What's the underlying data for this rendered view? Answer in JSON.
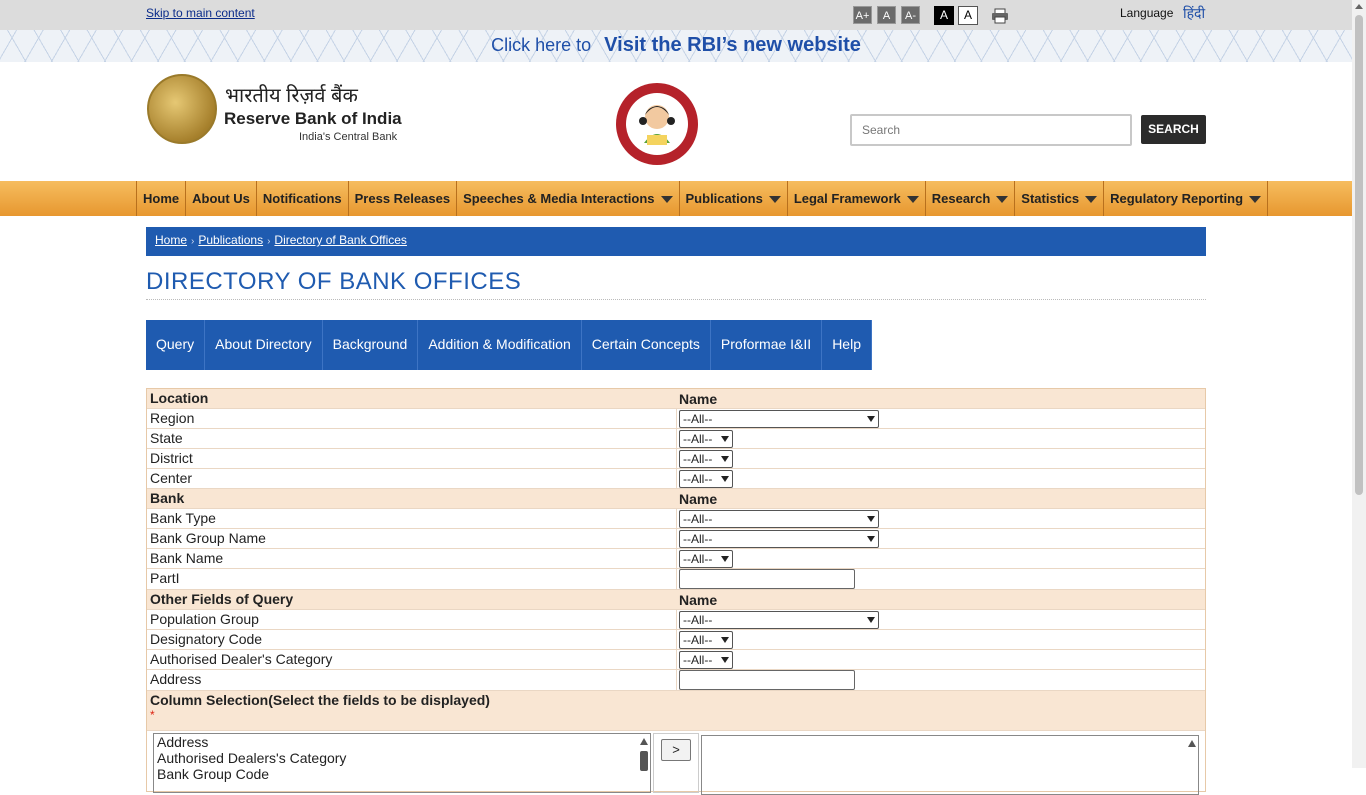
{
  "top": {
    "skip_link": "Skip to main content",
    "font_increase": "A+",
    "font_normal": "A",
    "font_decrease": "A-",
    "contrast_dark": "A",
    "contrast_light": "A",
    "language_label": "Language",
    "language_hindi": "हिंदी"
  },
  "banner": {
    "prefix": "Click here to",
    "link": "Visit the RBI’s new website"
  },
  "header": {
    "name_hindi": "भारतीय रिज़र्व बैंक",
    "name": "Reserve Bank of India",
    "tagline": "India's Central Bank",
    "search_placeholder": "Search",
    "search_button": "SEARCH"
  },
  "nav": [
    {
      "label": "Home",
      "dropdown": false
    },
    {
      "label": "About Us",
      "dropdown": false
    },
    {
      "label": "Notifications",
      "dropdown": false
    },
    {
      "label": "Press Releases",
      "dropdown": false
    },
    {
      "label": "Speeches & Media Interactions",
      "dropdown": true
    },
    {
      "label": "Publications",
      "dropdown": true
    },
    {
      "label": "Legal Framework",
      "dropdown": true
    },
    {
      "label": "Research",
      "dropdown": true
    },
    {
      "label": "Statistics",
      "dropdown": true
    },
    {
      "label": "Regulatory Reporting",
      "dropdown": true
    }
  ],
  "breadcrumb": [
    "Home",
    "Publications",
    "Directory of Bank Offices"
  ],
  "page_title": "DIRECTORY OF BANK OFFICES",
  "tabs": [
    "Query",
    "About Directory",
    "Background",
    "Addition & Modification",
    "Certain Concepts",
    "Proformae I&II",
    "Help"
  ],
  "form": {
    "location_head": "Location",
    "name_head": "Name",
    "region": {
      "label": "Region",
      "value": "--All--"
    },
    "state": {
      "label": "State",
      "value": "--All--"
    },
    "district": {
      "label": "District",
      "value": "--All--"
    },
    "center": {
      "label": "Center",
      "value": "--All--"
    },
    "bank_head": "Bank",
    "bank_type": {
      "label": "Bank Type",
      "value": "--All--"
    },
    "bank_group": {
      "label": "Bank Group Name",
      "value": "--All--"
    },
    "bank_name": {
      "label": "Bank Name",
      "value": "--All--"
    },
    "part1": {
      "label": "PartI",
      "value": ""
    },
    "other_head": "Other Fields of Query",
    "population": {
      "label": "Population Group",
      "value": "--All--"
    },
    "designatory": {
      "label": "Designatory Code",
      "value": "--All--"
    },
    "ad_category": {
      "label": "Authorised Dealer's Category",
      "value": "--All--"
    },
    "address": {
      "label": "Address",
      "value": ""
    },
    "column_selection": "Column Selection(Select the fields to be displayed)",
    "required_mark": "*",
    "available_columns": [
      "Address",
      "Authorised Dealers's Category",
      "Bank Group Code"
    ],
    "move_button": ">"
  },
  "colors": {
    "primary_blue": "#1f5bb0",
    "nav_orange": "#e7972f",
    "form_head_bg": "#f9e6d3"
  }
}
